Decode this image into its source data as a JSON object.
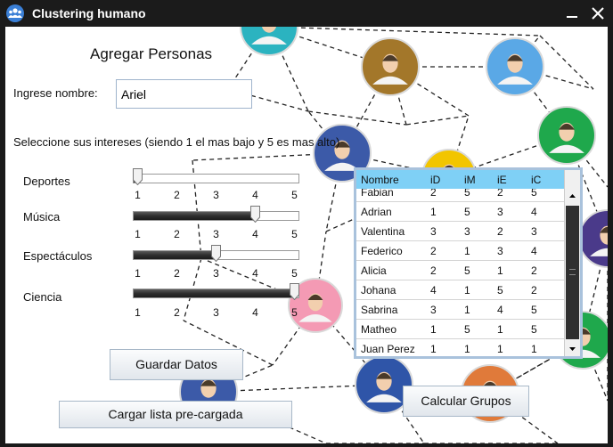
{
  "window": {
    "title": "Clustering humano"
  },
  "form": {
    "heading": "Agregar Personas",
    "name_label": "Ingrese nombre:",
    "name_value": "Ariel",
    "interests_label": "Seleccione sus intereses (siendo 1 el mas bajo y 5 es mas alto)"
  },
  "sliders": [
    {
      "label": "Deportes",
      "value": 1,
      "min": 1,
      "max": 5,
      "ticks": [
        "1",
        "2",
        "3",
        "4",
        "5"
      ]
    },
    {
      "label": "Música",
      "value": 4,
      "min": 1,
      "max": 5,
      "ticks": [
        "1",
        "2",
        "3",
        "4",
        "5"
      ]
    },
    {
      "label": "Espectáculos",
      "value": 3,
      "min": 1,
      "max": 5,
      "ticks": [
        "1",
        "2",
        "3",
        "4",
        "5"
      ]
    },
    {
      "label": "Ciencia",
      "value": 5,
      "min": 1,
      "max": 5,
      "ticks": [
        "1",
        "2",
        "3",
        "4",
        "5"
      ]
    }
  ],
  "buttons": {
    "save": "Guardar Datos",
    "load": "Cargar lista pre-cargada",
    "calc": "Calcular Grupos"
  },
  "table": {
    "columns": [
      "Nombre",
      "iD",
      "iM",
      "iE",
      "iC"
    ],
    "rows": [
      [
        "Fabian",
        "2",
        "5",
        "2",
        "5"
      ],
      [
        "Adrian",
        "1",
        "5",
        "3",
        "4"
      ],
      [
        "Valentina",
        "3",
        "3",
        "2",
        "3"
      ],
      [
        "Federico",
        "2",
        "1",
        "3",
        "4"
      ],
      [
        "Alicia",
        "2",
        "5",
        "1",
        "2"
      ],
      [
        "Johana",
        "4",
        "1",
        "5",
        "2"
      ],
      [
        "Sabrina",
        "3",
        "1",
        "4",
        "5"
      ],
      [
        "Matheo",
        "1",
        "5",
        "1",
        "5"
      ],
      [
        "Juan Perez",
        "1",
        "1",
        "1",
        "1"
      ]
    ]
  },
  "colors": {
    "table_header": "#7fd0f6",
    "table_border": "#a9c2dc",
    "titlebar": "#1b1b1b"
  }
}
